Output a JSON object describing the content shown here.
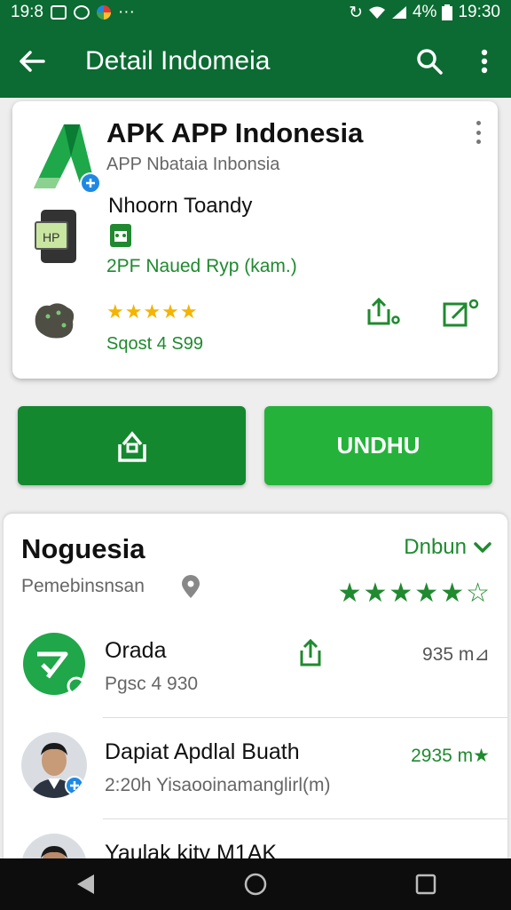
{
  "status_bar": {
    "time": "19:8",
    "battery": "4%",
    "clock": "19:30",
    "more": "···"
  },
  "app_bar": {
    "title": "Detail Indomeia"
  },
  "app_card": {
    "name": "APK APP Indonesia",
    "subtitle": "APP Nbataia Inbonsia",
    "whats_new": "Nhoorn Toandy",
    "version": "2PF Naued Ryp (kam.)",
    "rating_stars": 4.5,
    "stars_text": "★★★★★",
    "size": "Sqost 4 S99"
  },
  "buttons": {
    "download_label": "UNDHU"
  },
  "reviews": {
    "title": "Noguesia",
    "dropdown_label": "Dnbun",
    "subtitle": "Pemebinsnsan",
    "stars_text": "★★★★★☆",
    "items": [
      {
        "title": "Orada",
        "subtitle": "Pgsc 4 930",
        "value": "935 m⊿"
      },
      {
        "title": "Dapiat Apdlal Buath",
        "subtitle": "2:20h Yisaooinamanglirl(m)",
        "value": "2935 m★"
      },
      {
        "title": "Yaulak kity M1AK",
        "subtitle": "",
        "value": ""
      }
    ]
  },
  "colors": {
    "primary": "#0b6b32",
    "accent": "#25b23a",
    "star_yellow": "#f4b400"
  }
}
